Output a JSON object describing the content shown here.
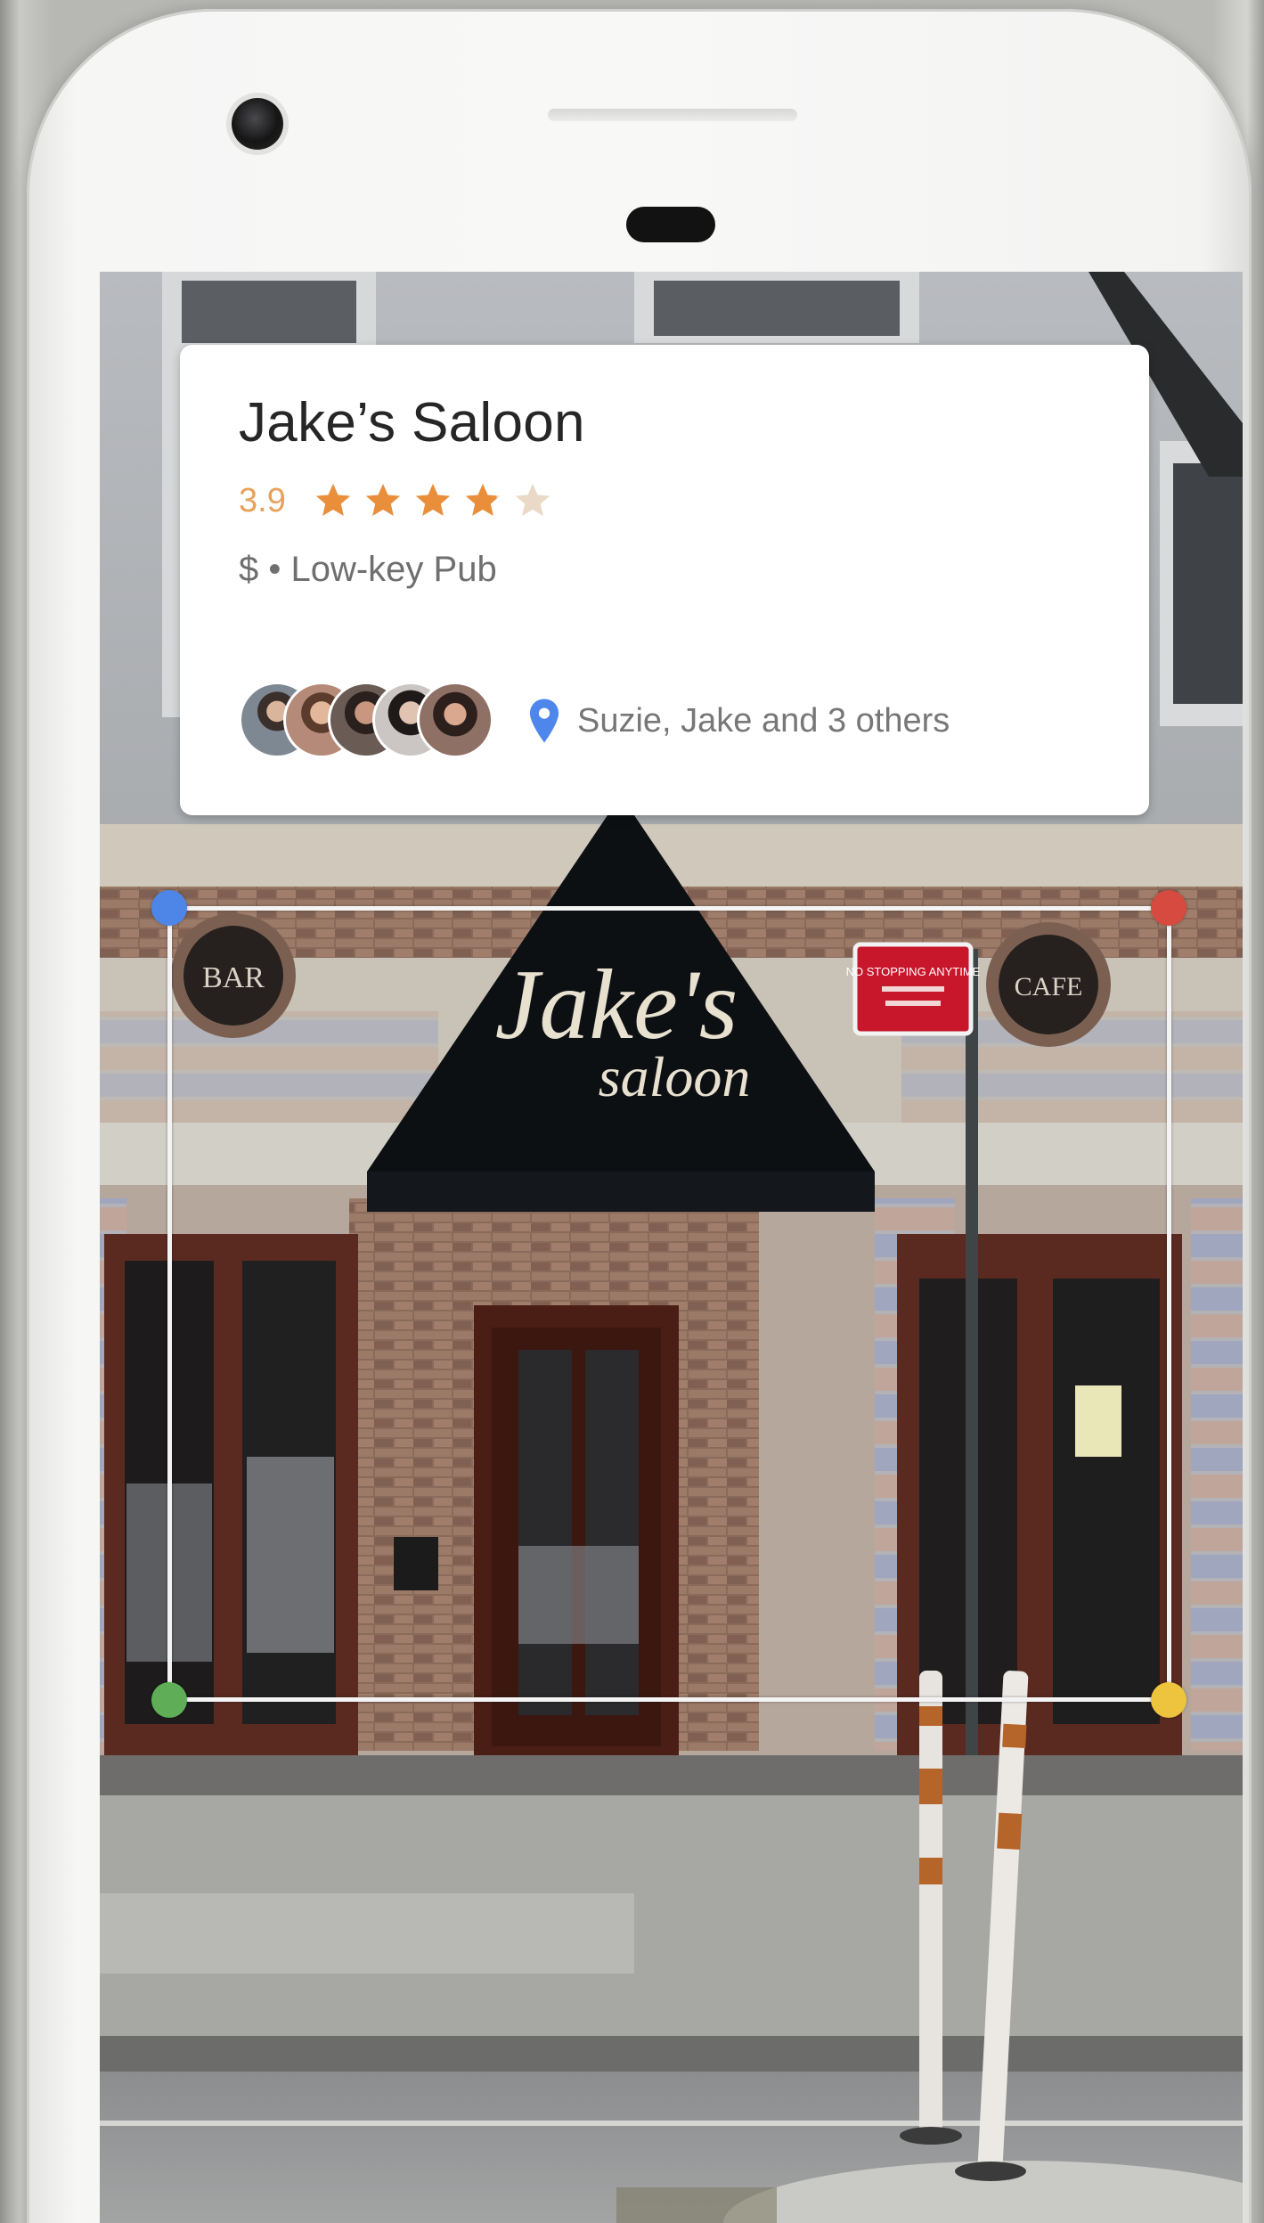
{
  "card": {
    "title": "Jake’s Saloon",
    "rating": "3.9",
    "stars": 3.9,
    "subline": "$ • Low-key Pub",
    "friends": "Suzie, Jake and 3 others",
    "colors": {
      "rating": "#e7a15b",
      "star": "#e98f3c",
      "pin": "#4f86ec"
    }
  },
  "storefront": {
    "awning_line1": "Jake's",
    "awning_line2": "saloon",
    "left_medallion": "BAR",
    "right_medallion": "CAFE",
    "sign": "NO STOPPING ANYTIME"
  },
  "selection": {
    "colors": {
      "top_left": "#4e86e8",
      "top_right": "#d64a3f",
      "bottom_left": "#5fae57",
      "bottom_right": "#eec33d"
    }
  }
}
